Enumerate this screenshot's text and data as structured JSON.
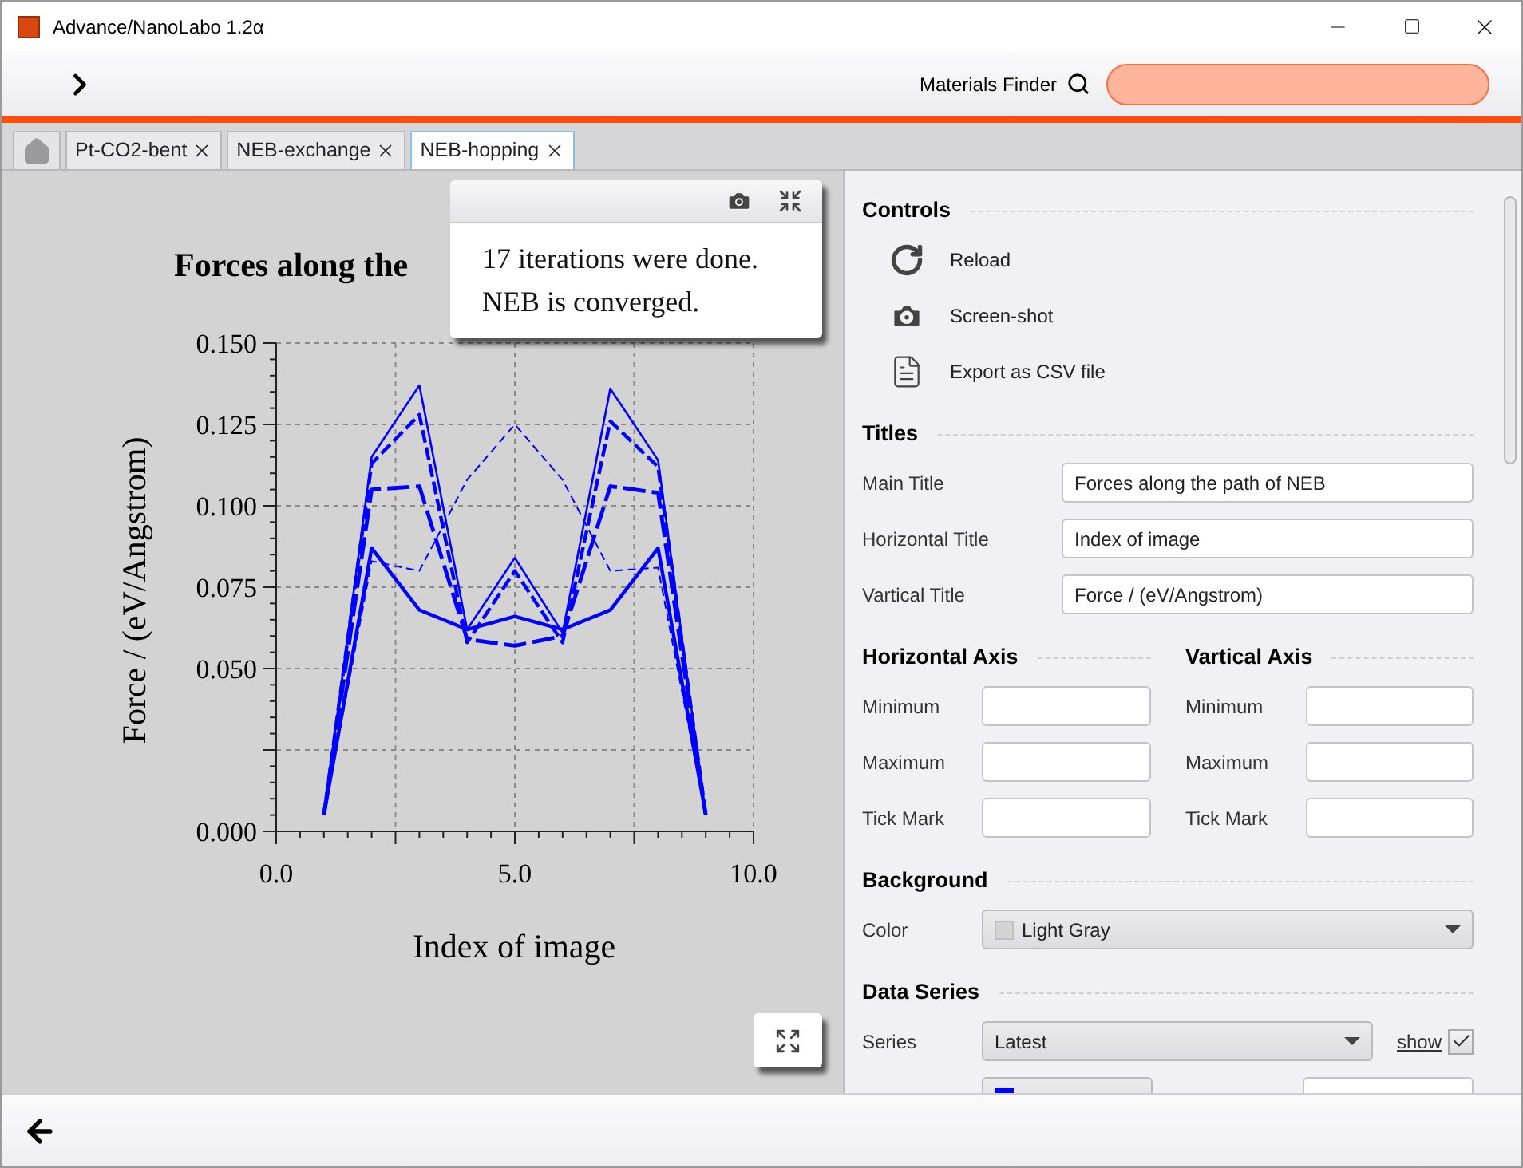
{
  "window": {
    "title": "Advance/NanoLabo 1.2α"
  },
  "toolbar": {
    "finder_label": "Materials Finder"
  },
  "tabs": [
    {
      "label": "Pt-CO2-bent",
      "selected": false
    },
    {
      "label": "NEB-exchange",
      "selected": false
    },
    {
      "label": "NEB-hopping",
      "selected": true
    }
  ],
  "chart": {
    "popup": {
      "lines": [
        "17 iterations were done.",
        "NEB is converged."
      ]
    },
    "chart_data": {
      "type": "line",
      "title": "Forces along the",
      "xlabel": "Index of image",
      "ylabel": "Force / (eV/Angstrom)",
      "x": [
        1,
        2,
        3,
        4,
        5,
        6,
        7,
        8,
        9
      ],
      "series": [
        {
          "color": "#0000ff",
          "line_style": "solid",
          "values": [
            0.005,
            0.115,
            0.137,
            0.062,
            0.084,
            0.061,
            0.136,
            0.114,
            0.005
          ]
        },
        {
          "color": "#0000ff",
          "line_style": "dashed",
          "values": [
            0.005,
            0.113,
            0.128,
            0.058,
            0.08,
            0.058,
            0.126,
            0.112,
            0.005
          ]
        },
        {
          "color": "#0000ff",
          "line_style": "dashed",
          "values": [
            0.005,
            0.083,
            0.08,
            0.108,
            0.125,
            0.108,
            0.08,
            0.081,
            0.005
          ]
        },
        {
          "color": "#0000ff",
          "line_style": "dashed",
          "values": [
            0.005,
            0.105,
            0.106,
            0.059,
            0.057,
            0.06,
            0.106,
            0.104,
            0.005
          ]
        },
        {
          "color": "#0000ff",
          "line_style": "solid",
          "values": [
            0.005,
            0.087,
            0.068,
            0.062,
            0.066,
            0.062,
            0.068,
            0.087,
            0.005
          ]
        }
      ],
      "xlim": [
        0,
        10
      ],
      "ylim": [
        0,
        0.15
      ],
      "grid": true,
      "xticks": [
        {
          "value": 0,
          "label": "0.0"
        },
        {
          "value": 5,
          "label": "5.0"
        },
        {
          "value": 10,
          "label": "10.0"
        }
      ],
      "yticks": [
        {
          "value": 0,
          "label": "0.000"
        },
        {
          "value": 0.05,
          "label": "0.050"
        },
        {
          "value": 0.075,
          "label": "0.075"
        },
        {
          "value": 0.1,
          "label": "0.100"
        },
        {
          "value": 0.125,
          "label": "0.125"
        },
        {
          "value": 0.15,
          "label": "0.150"
        }
      ]
    }
  },
  "controls": {
    "title": "Controls",
    "actions": [
      {
        "kind": "reload",
        "label": "Reload"
      },
      {
        "kind": "camera",
        "label": "Screen-shot"
      },
      {
        "kind": "document",
        "label": "Export as CSV file"
      }
    ]
  },
  "titles": {
    "title": "Titles",
    "fields": [
      {
        "label": "Main Title",
        "value": "Forces along the path of NEB"
      },
      {
        "label": "Horizontal Title",
        "value": "Index of image"
      },
      {
        "label": "Vartical Title",
        "value": "Force / (eV/Angstrom)"
      }
    ]
  },
  "axes": [
    {
      "title": "Horizontal Axis",
      "fields": [
        {
          "label": "Minimum"
        },
        {
          "label": "Maximum"
        },
        {
          "label": "Tick Mark"
        }
      ]
    },
    {
      "title": "Vartical Axis",
      "fields": [
        {
          "label": "Minimum"
        },
        {
          "label": "Maximum"
        },
        {
          "label": "Tick Mark"
        }
      ]
    }
  ],
  "background": {
    "title": "Background",
    "label": "Color",
    "value": "Light Gray"
  },
  "data_series": {
    "title": "Data Series",
    "label": "Series",
    "value": "Latest",
    "show_label": "show",
    "show_checked": true
  }
}
